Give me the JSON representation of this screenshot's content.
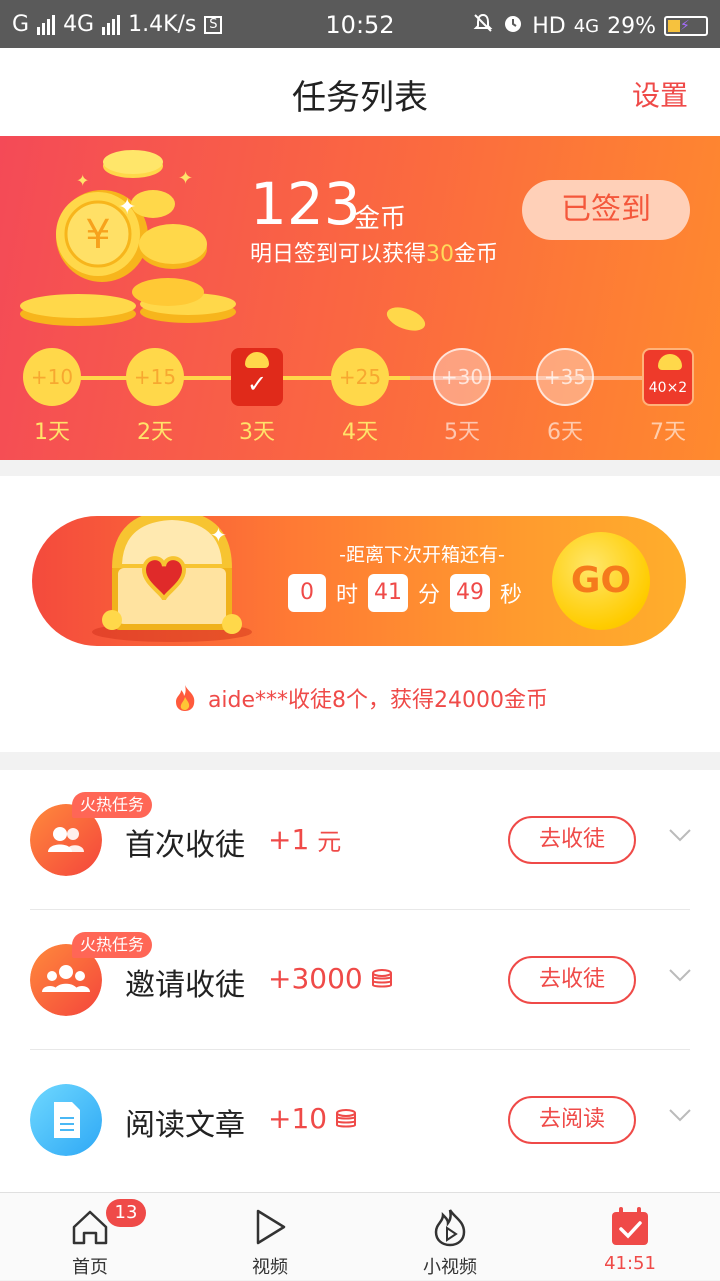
{
  "status_bar": {
    "carrier": "G",
    "network": "4G",
    "speed": "1.4K/s",
    "time": "10:52",
    "hd": "HD",
    "net2": "4G",
    "battery": "29%"
  },
  "header": {
    "title": "任务列表",
    "settings": "设置"
  },
  "checkin": {
    "coins": "123",
    "coins_unit": "金币",
    "tip_prefix": "明日签到可以获得",
    "tip_amount": "30",
    "tip_suffix": "金币",
    "signed_button": "已签到",
    "days": [
      {
        "reward": "+10",
        "label": "1天",
        "state": "claimed"
      },
      {
        "reward": "+15",
        "label": "2天",
        "state": "claimed"
      },
      {
        "reward": "",
        "label": "3天",
        "state": "today"
      },
      {
        "reward": "+25",
        "label": "4天",
        "state": "claimed"
      },
      {
        "reward": "+30",
        "label": "5天",
        "state": "future"
      },
      {
        "reward": "+35",
        "label": "6天",
        "state": "future"
      },
      {
        "reward": "40×2",
        "label": "7天",
        "state": "bonus"
      }
    ]
  },
  "chest": {
    "caption": "-距离下次开箱还有-",
    "hours": "0",
    "hours_unit": "时",
    "minutes": "41",
    "minutes_unit": "分",
    "seconds": "49",
    "seconds_unit": "秒",
    "go": "GO"
  },
  "broadcast": "aide***收徒8个，获得24000金币",
  "tasks": [
    {
      "badge": "火热任务",
      "name": "首次收徒",
      "reward": "+1",
      "unit": "元",
      "action": "去收徒",
      "icon": "users-icon"
    },
    {
      "badge": "火热任务",
      "name": "邀请收徒",
      "reward": "+3000",
      "unit": "",
      "action": "去收徒",
      "icon": "group-icon"
    },
    {
      "badge": "",
      "name": "阅读文章",
      "reward": "+10",
      "unit": "",
      "action": "去阅读",
      "icon": "document-icon"
    }
  ],
  "nav": {
    "home": "首页",
    "home_badge": "13",
    "video": "视频",
    "short_video": "小视频",
    "tasks": "41:51"
  },
  "colors": {
    "accent": "#ef4a48",
    "gold": "#ffd84a",
    "banner_start": "#f44a57",
    "banner_end": "#ff8a2e"
  }
}
